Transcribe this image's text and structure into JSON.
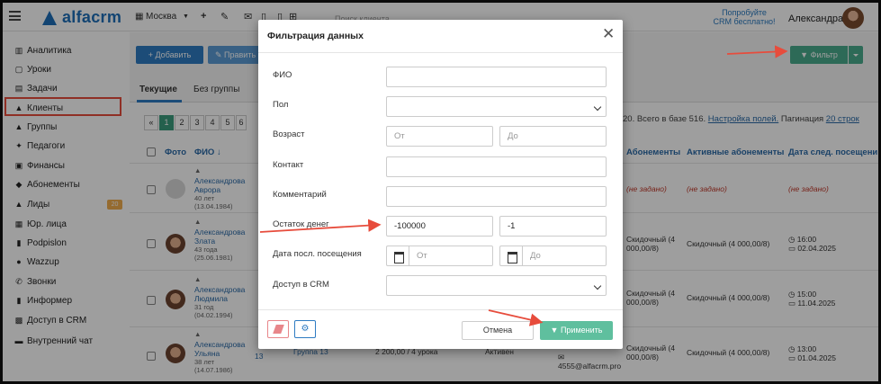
{
  "topbar": {
    "logo": "alfacrm",
    "city": "Москва",
    "search_placeholder": "Поиск клиента",
    "promo_line1": "Попробуйте",
    "promo_line2": "CRM бесплатно!",
    "user_name": "Александра"
  },
  "sidebar": {
    "items": [
      {
        "icon": "chart-icon",
        "glyph": "▥",
        "label": "Аналитика"
      },
      {
        "icon": "lessons-icon",
        "glyph": "▢",
        "label": "Уроки"
      },
      {
        "icon": "tasks-icon",
        "glyph": "▤",
        "label": "Задачи"
      },
      {
        "icon": "user-icon",
        "glyph": "▲",
        "label": "Клиенты"
      },
      {
        "icon": "group-icon",
        "glyph": "▲",
        "label": "Группы"
      },
      {
        "icon": "teacher-icon",
        "glyph": "✦",
        "label": "Педагоги"
      },
      {
        "icon": "finance-icon",
        "glyph": "▣",
        "label": "Финансы"
      },
      {
        "icon": "tag-icon",
        "glyph": "◆",
        "label": "Абонементы"
      },
      {
        "icon": "leads-icon",
        "glyph": "▲",
        "label": "Лиды",
        "badge": "20"
      },
      {
        "icon": "building-icon",
        "glyph": "▦",
        "label": "Юр. лица"
      },
      {
        "icon": "doc-icon",
        "glyph": "▮",
        "label": "Podpislon"
      },
      {
        "icon": "whatsapp-icon",
        "glyph": "●",
        "label": "Wazzup"
      },
      {
        "icon": "phone-icon",
        "glyph": "✆",
        "label": "Звонки"
      },
      {
        "icon": "informer-icon",
        "glyph": "▮",
        "label": "Информер"
      },
      {
        "icon": "lock-icon",
        "glyph": "▩",
        "label": "Доступ в CRM"
      },
      {
        "icon": "chat-icon",
        "glyph": "▬",
        "label": "Внутренний чат"
      }
    ]
  },
  "toolbar": {
    "add_label": "+ Добавить",
    "edit_label": "Править",
    "filter_label": "Фильтр"
  },
  "tabs": [
    "Текущие",
    "Без группы"
  ],
  "pagination": {
    "prev": "«",
    "pages": [
      "1",
      "2",
      "3",
      "4",
      "5",
      "6"
    ],
    "current": "1",
    "info_text": "20. Всего в базе 516.",
    "settings_link": "Настройка полей.",
    "pagination_label": "Пагинация",
    "pagination_value": "20 строк"
  },
  "table": {
    "headers": {
      "photo": "Фото",
      "fio": "ФИО ↓",
      "subscriptions": "Абонементы",
      "active_subscriptions": "Активные абонементы",
      "next_visit": "Дата след. посещени"
    },
    "rows": [
      {
        "name1": "Александрова",
        "name2": "Аврора",
        "age": "40 лет",
        "birth": "(13.04.1984)",
        "subs": "(не задано)",
        "active": "(не задано)",
        "next_time": "",
        "next_date": "(не задано)"
      },
      {
        "name1": "Александрова",
        "name2": "Злата",
        "age": "43 года",
        "birth": "(25.06.1981)",
        "subs": "Скидочный (4 000,00/8)",
        "active": "Скидочный (4 000,00/8)",
        "next_time": "◷ 16:00",
        "next_date": "▭ 02.04.2025"
      },
      {
        "name1": "Александрова",
        "name2": "Людмила",
        "age": "31 год",
        "birth": "(04.02.1994)",
        "subs": "Скидочный (4 000,00/8)",
        "active": "Скидочный (4 000,00/8)",
        "next_time": "◷ 15:00",
        "next_date": "▭ 11.04.2025"
      },
      {
        "name1": "Александрова",
        "name2": "Ульяна",
        "age": "38 лет",
        "birth": "(14.07.1986)",
        "subs": "Скидочный (4 000,00/8)",
        "active": "Скидочный (4 000,00/8)",
        "next_time": "◷ 13:00",
        "next_date": "▭ 01.04.2025"
      }
    ],
    "row4_extra": {
      "group": "Группа 13",
      "group_prefix": "13",
      "balance": "2 200,00 / 4 урока",
      "status": "Активен",
      "email": "4555@alfacrm.pro"
    }
  },
  "modal": {
    "title": "Фильтрация данных",
    "close": "✕",
    "fields": {
      "fio": {
        "label": "ФИО",
        "value": ""
      },
      "gender": {
        "label": "Пол",
        "value": ""
      },
      "age": {
        "label": "Возраст",
        "from_placeholder": "От",
        "to_placeholder": "До"
      },
      "contact": {
        "label": "Контакт",
        "value": ""
      },
      "comment": {
        "label": "Комментарий",
        "value": ""
      },
      "balance": {
        "label": "Остаток денег",
        "from_value": "-100000",
        "to_value": "-1"
      },
      "last_visit": {
        "label": "Дата посл. посещения",
        "from_placeholder": "От",
        "to_placeholder": "До"
      },
      "crm_access": {
        "label": "Доступ в CRM",
        "value": ""
      }
    },
    "cancel_label": "Отмена",
    "apply_label": "Применить"
  },
  "colors": {
    "brand": "#1e6fb9",
    "filter_green": "#4aab8d",
    "apply_green": "#5fbf9e",
    "annotation_red": "#e74c3c"
  }
}
